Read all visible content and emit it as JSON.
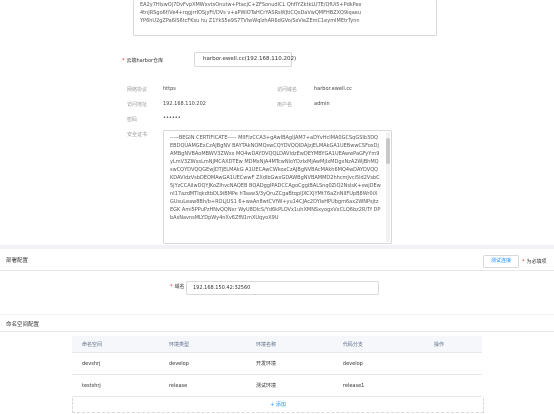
{
  "top_cert_snippet": {
    "lines": [
      "EA2y7HlswOj7DvFvpXMWxvtsOnutw+PtacjC+ZFSonudlCL QhfIYZktkLUTE/QfUi5+PdkPex",
      "4tnJRSgo6f/Ve4+rqgjrrIOSjyFt/DVs v+aPWiOTaHCrYASRsWJtiCQsDaVwQMFHBZXQ9iqaeu",
      "YP6hU2gZPa6iS6tcFKsu hu Z1YkS5e9S7TVlwWqlzhAR6dGVo/SsVieZEmC1eymIMEtrTynn"
    ]
  },
  "repo_select": {
    "label": "云端harbor仓库",
    "value": "harbor.ewell.cc(192.168.110.202)"
  },
  "info": {
    "network_addr_label": "网络协议",
    "network_addr_value": "https",
    "access_domain_label": "访问域名",
    "access_domain_value": "harbor.ewell.cc",
    "access_addr_label": "访问地址",
    "access_addr_value": "192.168.110.202",
    "username_label": "用户名",
    "username_value": "admin",
    "password_label": "密码",
    "password_value": "••••••",
    "cert_label": "安全证书"
  },
  "cert_text": "-----BEGIN CERTIFICATE----- MIIFIzCCA3+gAwIBAgIJAM7+aDYvHcIMA0GCSqGSIb3DQEBDQUAMGExCzAJBgNV BAYTAkNOMQswCQYDVQQIDAJzjELMAkGA1UEBwwCSFoxDjAMBgNVBAoMBWV3ZWxs MQ4wDAYDVQQLDAVldzEwDEYMBYGA1UEAwwPaGFyYm9yLmV3ZWxsLmNjMCAXDTEw MDMxNjA4MTcwNloYDzIxMjAwMjIxMDgxNzA2WjBhMQswCQYDVQQGEwJDTjELMAkG A1UECAwCWkoxCzAJBgNVBAcMAkh6MQ4wDAYDVQQKDAVldzVsbDEOMAwGA1UECwwF ZXdlbGwxGDAWBgNVBAMMD2hhcmJvci5ld2VsbC5jYzCCAiIwDQYJKoZIhvcNAQEB BQADggIPADCCAgoCggIBALSnq0ZiQ2NsIsK+swjDEwnI17azdMTlqkdtbDL9iBMPe hTaaw3/3yQruZCgaBtqpIJXCXjYMt76aZnNlIFUpB8Wr0iXGUsuLeaw8Bh/b+ROLJUS1 6+waAn8wtCVfW+yu14CJAc2DYIeHPUbgm6ax2WNPsjtzEGK Ami5PPuPzHNvQQNxr WyU8DIcS/Yd6kPLOVx1uhXMNSxyogxVxCLQ6bz2R/Tf DPbAsNavnsMLYDpWy4nXv6ZfN1mXUqyoX9U",
  "deploy": {
    "section_title": "部署配置",
    "test_button": "测试连接",
    "required_hint": "为必填项",
    "domain_label": "域名",
    "domain_value": "192.168.150.42:32560"
  },
  "namespace": {
    "section_title": "命名空间配置",
    "columns": [
      "命名空间",
      "环境类型",
      "环境名称",
      "代码分支",
      "操作"
    ],
    "rows": [
      {
        "ns": "devshrj",
        "env_type": "develop",
        "env_name": "开发环境",
        "branch": "develop",
        "op": ""
      },
      {
        "ns": "testshrj",
        "env_type": "release",
        "env_name": "测试环境",
        "branch": "release1",
        "op": ""
      }
    ],
    "add_label": "+ 添加"
  }
}
